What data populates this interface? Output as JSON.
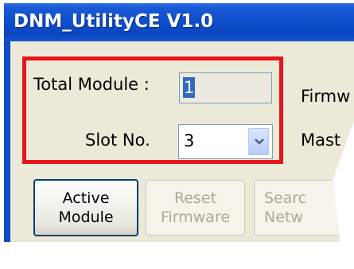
{
  "window": {
    "title": "DNM_UtilityCE V1.0"
  },
  "form": {
    "total_module_label": "Total Module :",
    "total_module_value": "1",
    "slot_no_label": "Slot No.",
    "slot_no_value": "3",
    "firmware_label_partial": "Firmw",
    "master_label_partial": "Mast"
  },
  "buttons": {
    "active_module": [
      "Active",
      "Module"
    ],
    "reset_firmware": [
      "Reset",
      "Firmware"
    ],
    "search_network": [
      "Searc",
      "Netw"
    ]
  },
  "colors": {
    "titlebar": "#0c4bc9",
    "window_bg": "#ece9d8",
    "highlight_border": "#e8141a",
    "selection": "#316ac5"
  },
  "icons": {
    "dropdown": "chevron-down-icon"
  }
}
